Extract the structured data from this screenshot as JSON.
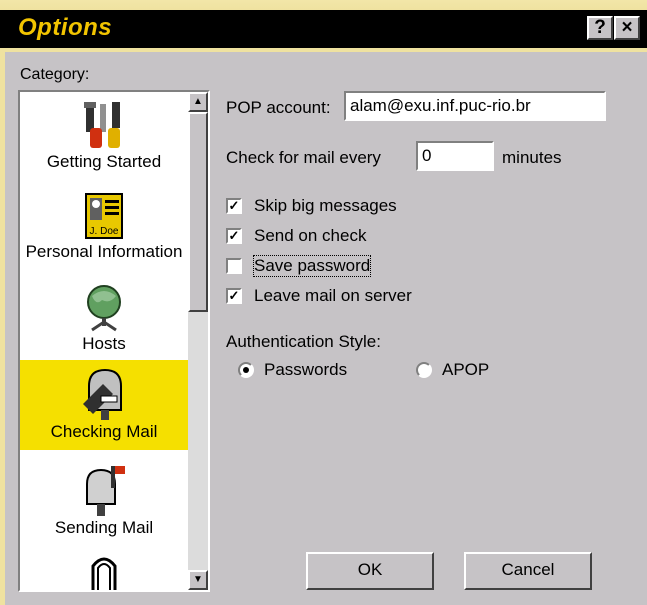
{
  "window": {
    "title": "Options",
    "help_button": "?",
    "close_button": "×"
  },
  "category": {
    "label": "Category:",
    "items": [
      {
        "label": "Getting Started",
        "icon": "tools-icon"
      },
      {
        "label": "Personal Information",
        "icon": "id-card-icon"
      },
      {
        "label": "Hosts",
        "icon": "globe-icon"
      },
      {
        "label": "Checking Mail",
        "icon": "mailbox-open-icon",
        "selected": true
      },
      {
        "label": "Sending Mail",
        "icon": "mailbox-flag-icon"
      },
      {
        "label": "",
        "icon": "arch-icon"
      }
    ]
  },
  "pop_account": {
    "label": "POP account:",
    "value": "alam@exu.inf.puc-rio.br"
  },
  "check_mail": {
    "label": "Check for mail every",
    "value": "0",
    "suffix": "minutes"
  },
  "checkboxes": [
    {
      "label": "Skip big messages",
      "checked": true
    },
    {
      "label": "Send on check",
      "checked": true
    },
    {
      "label": "Save password",
      "checked": false
    },
    {
      "label": "Leave mail on server",
      "checked": true
    }
  ],
  "auth": {
    "label": "Authentication Style:",
    "options": [
      {
        "label": "Passwords",
        "selected": true
      },
      {
        "label": "APOP",
        "selected": false
      }
    ]
  },
  "buttons": {
    "ok": "OK",
    "cancel": "Cancel"
  },
  "colors": {
    "selection": "#f5e000",
    "title_text": "#f2c400",
    "face": "#c6c3c6"
  }
}
